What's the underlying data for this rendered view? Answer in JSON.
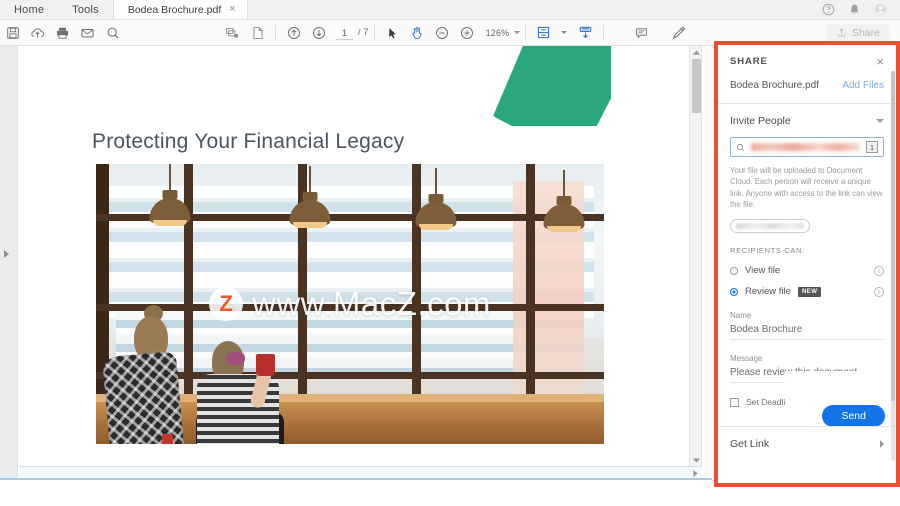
{
  "tabbar": {
    "home_label": "Home",
    "tools_label": "Tools",
    "document_tab_label": "Bodea Brochure.pdf",
    "close_tab_label": "×",
    "help_icon": "help-circle-icon",
    "bell_icon": "notification-bell-icon",
    "account_icon": "user-account-icon"
  },
  "toolbar": {
    "save_icon": "save-disk-icon",
    "upload_icon": "upload-cloud-icon",
    "print_icon": "printer-icon",
    "email_icon": "envelope-icon",
    "search_icon": "search-icon",
    "thumbnails_icon": "page-thumbnails-icon",
    "pages_icon": "page-panel-icon",
    "prev_page_icon": "arrow-up-circle-icon",
    "next_page_icon": "arrow-down-circle-icon",
    "page_number": "1",
    "page_total": "/ 7",
    "select_tool_icon": "cursor-arrow-icon",
    "hand_tool_icon": "hand-pan-icon",
    "zoom_out_icon": "minus-circle-icon",
    "zoom_in_icon": "plus-circle-icon",
    "zoom_level": "126%",
    "fit_page_icon": "fit-page-icon",
    "scroll_mode_icon": "scroll-mode-icon",
    "comment_icon": "comment-bubble-icon",
    "highlight_icon": "highlighter-pen-icon",
    "share_label": "Share",
    "share_icon": "share-upload-icon"
  },
  "document": {
    "title": "Protecting Your Financial Legacy",
    "watermark_badge": "Z",
    "watermark_text": "www.MacZ.com",
    "accent_green": "#2aa87c",
    "left_rail_expand_icon": "panel-expand-arrow-icon",
    "scroll_up_icon": "scroll-up-arrow-icon",
    "scroll_down_icon": "scroll-down-arrow-icon",
    "hscroll_right_icon": "scroll-right-arrow-icon"
  },
  "share_panel": {
    "highlight_color": "#f04e32",
    "title": "SHARE",
    "close_label": "×",
    "file_name": "Bodea Brochure.pdf",
    "add_files_label": "Add Files",
    "invite_people_label": "Invite People",
    "search_icon": "search-icon",
    "recipient_count": "1",
    "note_text": "Your file will be uploaded to Document Cloud. Each person will receive a unique link. Anyone with access to the link can view the file.",
    "recipients_can_label": "RECIPIENTS CAN:",
    "option_view_label": "View file",
    "option_review_label": "Review file",
    "new_badge": "NEW",
    "info_icon": "info-circle-icon",
    "name_label": "Name",
    "name_value": "Bodea Brochure",
    "message_label": "Message",
    "message_value": "Please review this document.",
    "set_deadline_label": "Set Deadline",
    "send_label": "Send",
    "send_color": "#1473e6",
    "get_link_label": "Get Link",
    "chevron_down_icon": "chevron-down-icon",
    "chevron_right_icon": "chevron-right-icon"
  }
}
